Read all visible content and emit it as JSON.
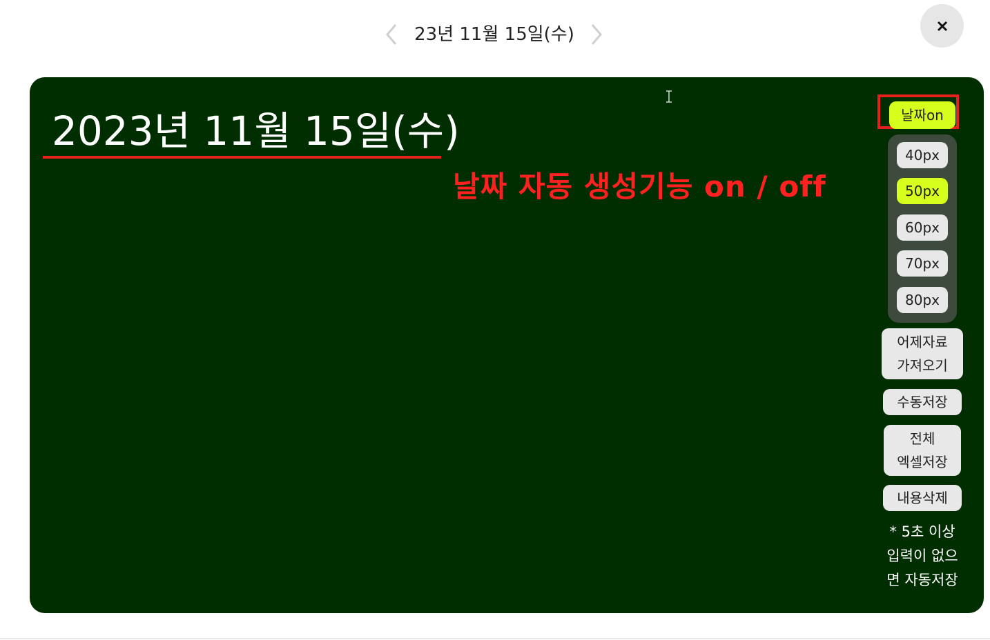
{
  "header": {
    "date_label": "23년 11월 15일(수)"
  },
  "board": {
    "date_title": "2023년 11월 15일(수)",
    "annotation": "날짜 자동 생성기능 on / off",
    "background": "#002e00"
  },
  "sidebar": {
    "date_toggle_label": "날짜on",
    "size_options": [
      "40px",
      "50px",
      "60px",
      "70px",
      "80px"
    ],
    "selected_size": "50px",
    "import_yesterday": [
      "어제자료",
      "가져오기"
    ],
    "manual_save": "수동저장",
    "excel_save": [
      "전체",
      "엑셀저장"
    ],
    "clear_content": "내용삭제",
    "autosave_note": [
      "* 5초 이상",
      "입력이 없으",
      "면 자동저장"
    ]
  },
  "colors": {
    "accent": "#d7ff1e",
    "highlight_red": "#e8201b",
    "button_bg": "#e8e8e8"
  },
  "icons": {
    "prev": "chevron-left-icon",
    "next": "chevron-right-icon",
    "close": "close-icon",
    "cursor": "text-cursor-icon"
  }
}
